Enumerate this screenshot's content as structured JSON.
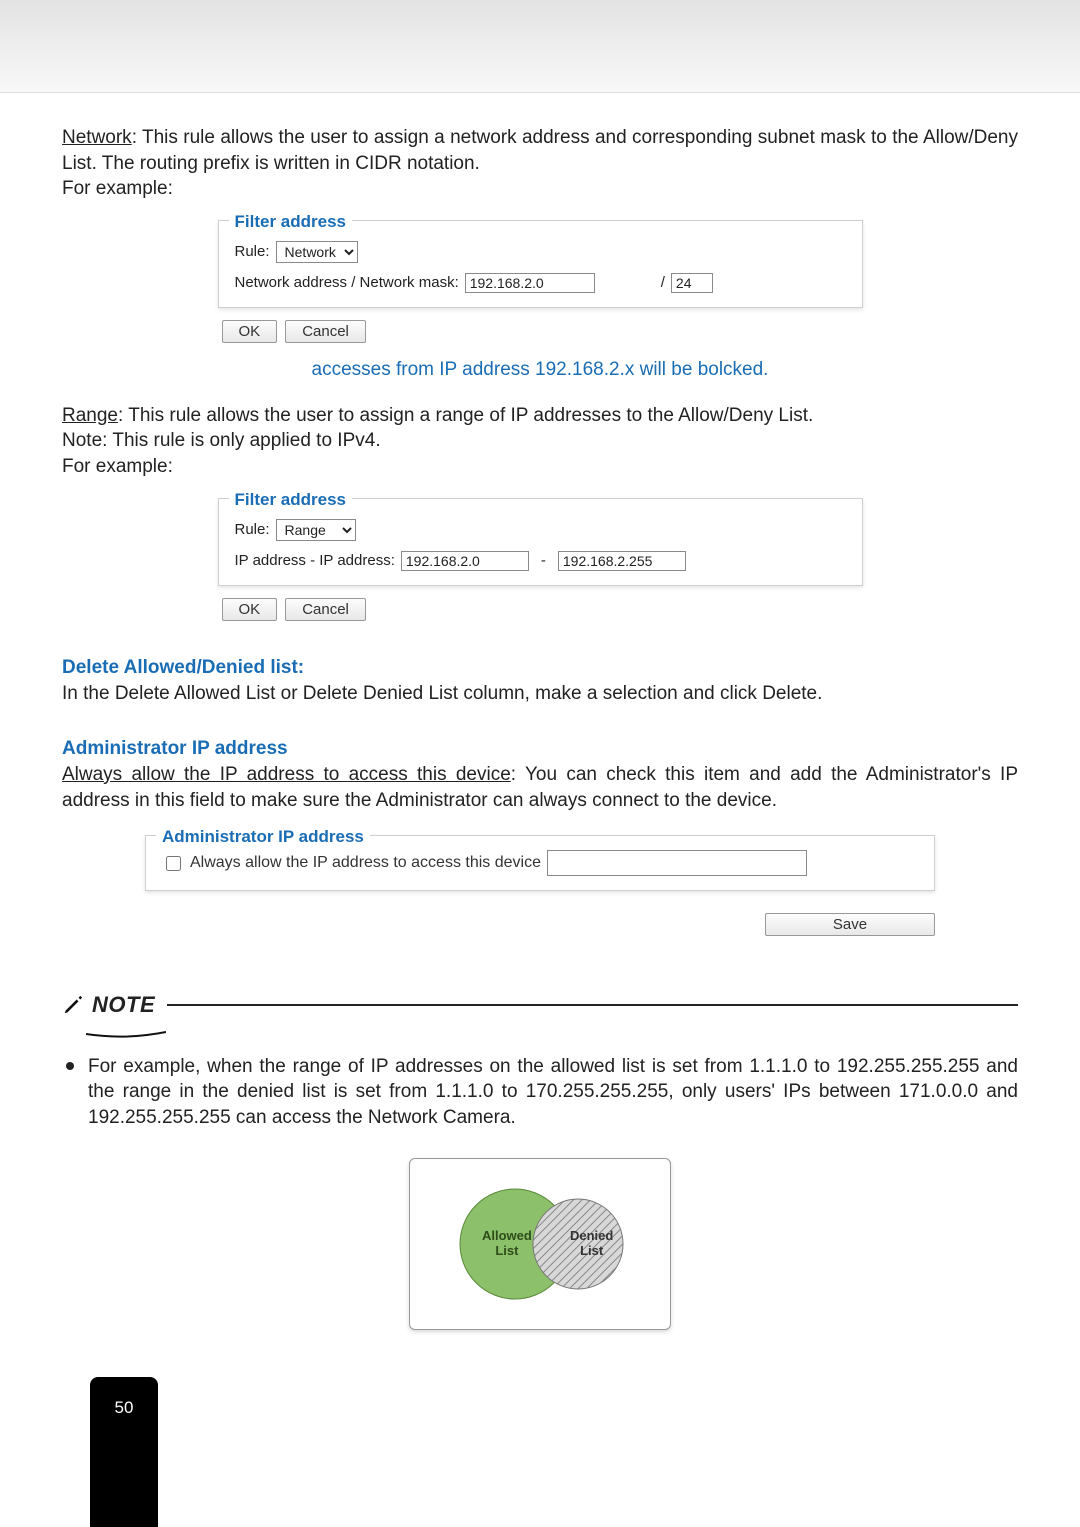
{
  "network": {
    "heading": "Network",
    "body": ": This rule allows the user to assign a network address and corresponding subnet mask to the Allow/Deny List. The routing prefix is written in CIDR notation.",
    "for_example": "For example:"
  },
  "shot_network": {
    "fieldset_title": "Filter address",
    "rule_label": "Rule:",
    "rule_value": "Network",
    "addr_label": "Network address / Network mask:",
    "addr_value": "192.168.2.0",
    "mask_sep": "/",
    "mask_value": "24",
    "ok": "OK",
    "cancel": "Cancel"
  },
  "caption1": "accesses from IP address 192.168.2.x will be bolcked.",
  "range": {
    "heading": "Range",
    "body": ": This rule allows the user to assign a range of IP addresses to the Allow/Deny List.",
    "note": "Note: This rule is only applied to IPv4.",
    "for_example": "For example:"
  },
  "shot_range": {
    "fieldset_title": "Filter address",
    "rule_label": "Rule:",
    "rule_value": "Range",
    "addr_label": "IP address - IP address:",
    "addr1": "192.168.2.0",
    "dash": "-",
    "addr2": "192.168.2.255",
    "ok": "OK",
    "cancel": "Cancel"
  },
  "delete": {
    "heading": "Delete Allowed/Denied list:",
    "body": "In the Delete Allowed List or Delete Denied List column, make a selection and click Delete."
  },
  "admin": {
    "heading": "Administrator IP address",
    "sub_u": "Always allow the IP address to access this device",
    "sub_rest": ": You can check this item and add the Administrator's IP address in this field to make sure the Administrator can always connect to the device."
  },
  "shot_admin": {
    "fieldset_title": "Administrator IP address",
    "chk_label": "Always allow the IP address to access this device",
    "ip_value": "",
    "save": "Save"
  },
  "note": {
    "label": "NOTE",
    "bullet": "For example, when the range of IP addresses on the allowed list is set from 1.1.1.0 to 192.255.255.255 and the range in the denied list is set from 1.1.1.0 to 170.255.255.255, only users' IPs between 171.0.0.0 and 192.255.255.255 can access the Network Camera."
  },
  "venn": {
    "allowed": "Allowed\nList",
    "denied": "Denied\nList"
  },
  "page_number": "50"
}
